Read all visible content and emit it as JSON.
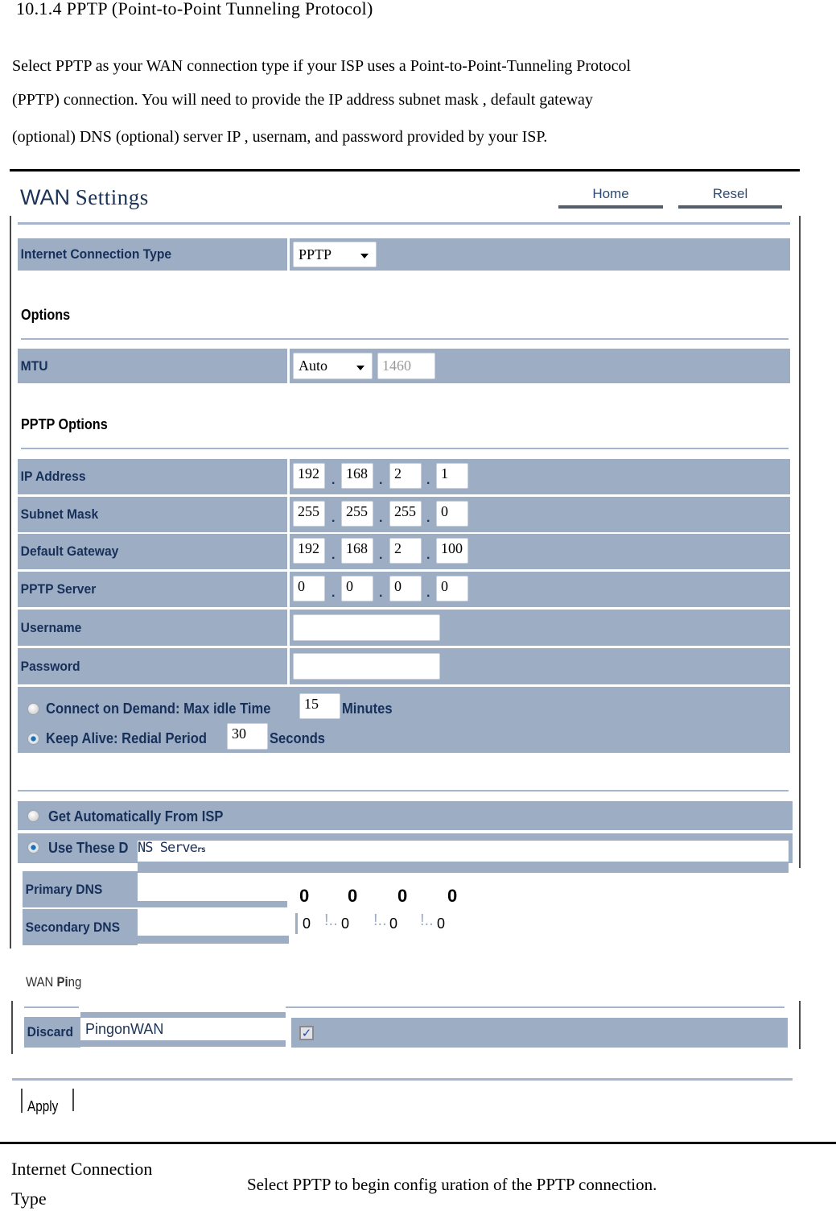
{
  "document": {
    "heading": "10.1.4 PPTP (Point-to-Point Tunneling Protocol)",
    "paragraph_lines": [
      "Select PPTP as your WAN connection  type if your ISP uses a Point-to-Point-Tunneling Protocol",
      "(PPTP) connection. You will need  to  provide the IP address   subnet   mask , default gateway",
      "(optional)   DNS (optional)   server IP , usernam, and  password  provided  by your ISP."
    ]
  },
  "screenshot": {
    "title_part1": "WAN",
    "title_part2": "Settings",
    "top_links": [
      {
        "label": "Home"
      },
      {
        "label": "Resel"
      }
    ],
    "connection_type": {
      "label": "Internet Connection Type",
      "selected": "PPTP"
    },
    "options_heading": "Options",
    "mtu": {
      "label": "MTU",
      "selected": "Auto",
      "value": "1460"
    },
    "pptp_options_heading": "PPTP Options",
    "ip_rows": [
      {
        "label": "IP Address",
        "octets": [
          "192",
          "168",
          "2",
          "1"
        ]
      },
      {
        "label": "Subnet Mask",
        "octets": [
          "255",
          "255",
          "255",
          "0"
        ]
      },
      {
        "label": "Default Gateway",
        "octets": [
          "192",
          "168",
          "2",
          "100"
        ]
      },
      {
        "label": "PPTP Server",
        "octets": [
          "0",
          "0",
          "0",
          "0"
        ]
      }
    ],
    "username": {
      "label": "Username",
      "value": ""
    },
    "password": {
      "label": "Password",
      "value": ""
    },
    "dot": ".",
    "connect_on_demand": {
      "label": "Connect on Demand: Max idle Time",
      "value": "15",
      "unit": "Minutes",
      "checked": false
    },
    "keep_alive": {
      "label": "Keep Alive: Redial Period",
      "value": "30",
      "unit": "Seconds",
      "checked": true
    },
    "dns_auto": {
      "label": "Get Automatically From ISP",
      "checked": false
    },
    "dns_manual": {
      "label_visible": "Use These D",
      "overlay_text": "NS Serve",
      "overlay_glyph": "rs",
      "checked": true
    },
    "primary_dns": {
      "label": "Primary DNS",
      "octets": [
        "0",
        "0",
        "0",
        "0"
      ]
    },
    "secondary_dns": {
      "label": "Secondary DNS",
      "octets": [
        "0",
        "0",
        "0",
        "0"
      ],
      "separator": "!.."
    },
    "wan_ping": {
      "heading_part1": "WAN",
      "heading_part2": "Pi",
      "heading_part3": "ng",
      "label_visible": "Discard",
      "overlay_text": "PingonWAN",
      "checked": true,
      "check_glyph": "✓"
    },
    "apply_label": "Apply"
  },
  "table": {
    "term_line1": "Internet  Connection",
    "term_line2": "Type",
    "description": "Select  PPTP to  begin  config uration  of the  PPTP connection."
  },
  "colors": {
    "row_bg": "#9dadc4",
    "label_text": "#17305a",
    "title_text": "#1c3358",
    "link_bar": "#555e69",
    "separator": "#a4b5cc"
  }
}
